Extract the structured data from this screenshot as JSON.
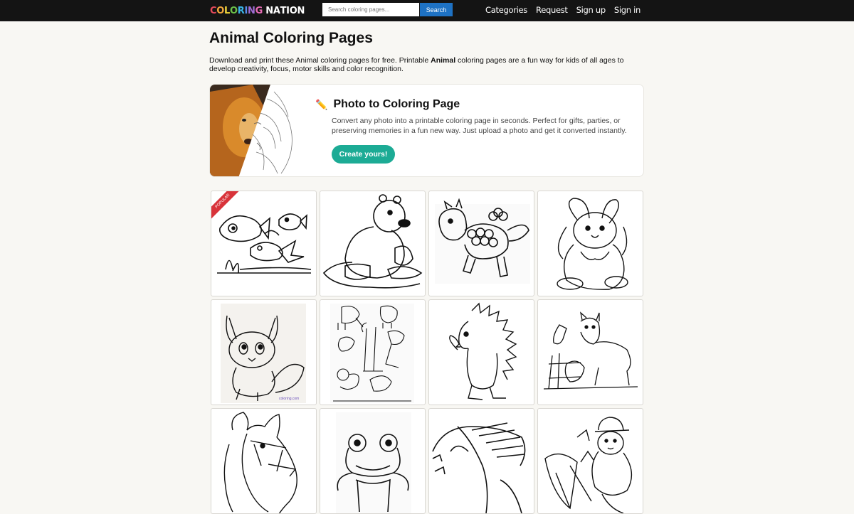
{
  "header": {
    "logo_letters": [
      {
        "ch": "C",
        "color": "#e84b5c"
      },
      {
        "ch": "O",
        "color": "#f3a83b"
      },
      {
        "ch": "L",
        "color": "#f3d83b"
      },
      {
        "ch": "O",
        "color": "#6cc24a"
      },
      {
        "ch": "R",
        "color": "#3bb5e8"
      },
      {
        "ch": "I",
        "color": "#5b8def"
      },
      {
        "ch": "N",
        "color": "#a06cd5"
      },
      {
        "ch": "G",
        "color": "#e86cb5"
      },
      {
        "ch": " ",
        "color": "#ffffff"
      },
      {
        "ch": "N",
        "color": "#ffffff"
      },
      {
        "ch": "A",
        "color": "#ffffff"
      },
      {
        "ch": "T",
        "color": "#ffffff"
      },
      {
        "ch": "I",
        "color": "#ffffff"
      },
      {
        "ch": "O",
        "color": "#ffffff"
      },
      {
        "ch": "N",
        "color": "#ffffff"
      }
    ],
    "search_placeholder": "Search coloring pages...",
    "search_button": "Search",
    "nav": [
      "Categories",
      "Request",
      "Sign up",
      "Sign in"
    ]
  },
  "page": {
    "title": "Animal Coloring Pages",
    "intro_before": "Download and print these Animal coloring pages for free. Printable ",
    "intro_bold": "Animal",
    "intro_after": " coloring pages are a fun way for kids of all ages to develop creativity, focus, motor skills and color recognition."
  },
  "promo": {
    "icon": "pencil-icon",
    "title": "Photo to Coloring Page",
    "description": "Convert any photo into a printable coloring page in seconds. Perfect for gifts, parties, or preserving memories in a fun new way. Just upload a photo and get it converted instantly.",
    "button": "Create yours!"
  },
  "gallery": {
    "ribbon": "POPULAR",
    "items": [
      "fish",
      "beaver",
      "pony",
      "bunny",
      "fox-cub",
      "zoo-animals",
      "hedgehog",
      "farm-horse",
      "horse-bridle",
      "frog",
      "fish-head",
      "bear-carrots"
    ]
  },
  "colors": {
    "accent": "#1cab95",
    "search_btn": "#1e72c4",
    "topbar": "#141414"
  }
}
